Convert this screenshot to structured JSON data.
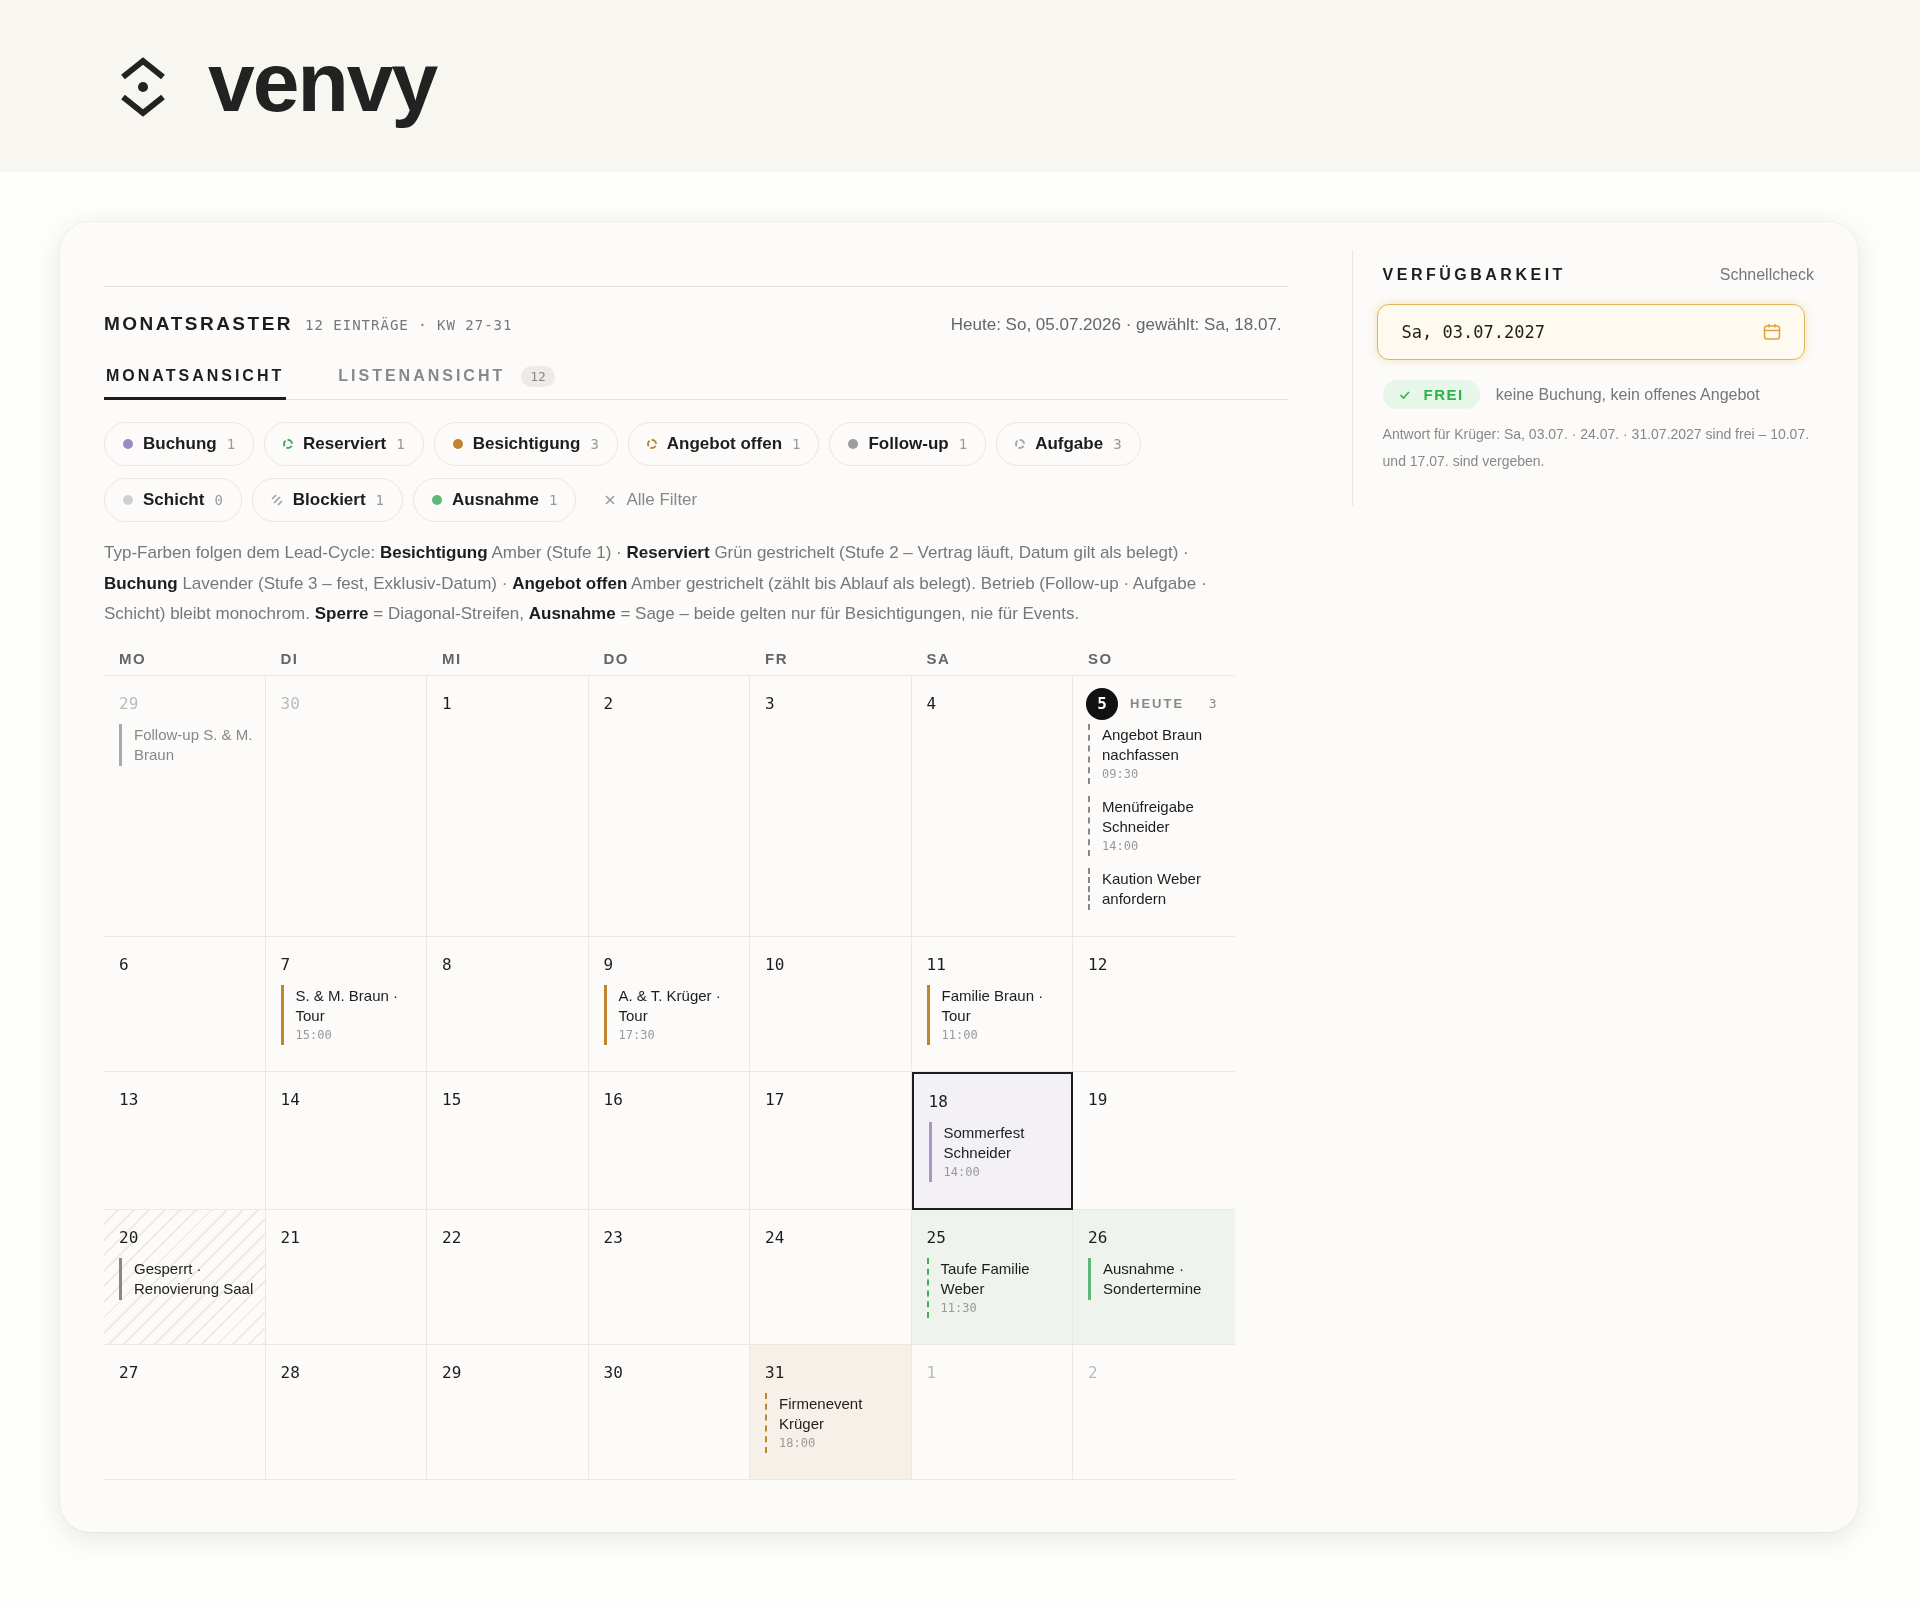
{
  "brand": {
    "name": "venvy"
  },
  "month": {
    "title": "MONATSRASTER",
    "meta": "12 EINTRÄGE · KW 27-31",
    "status": "Heute: So, 05.07.2026 · gewählt: Sa, 18.07.",
    "tabs": [
      {
        "label": "MONATSANSICHT",
        "selected": true
      },
      {
        "label": "LISTENANSICHT",
        "count": "12",
        "selected": false
      }
    ],
    "filters": [
      {
        "label": "Buchung",
        "count": "1",
        "kind": "dot",
        "color": "#9b8ac4"
      },
      {
        "label": "Reserviert",
        "count": "1",
        "kind": "ring",
        "color": "#3fae5c"
      },
      {
        "label": "Besichtigung",
        "count": "3",
        "kind": "dot",
        "color": "#c0842c"
      },
      {
        "label": "Angebot offen",
        "count": "1",
        "kind": "ring",
        "color": "#c0842c"
      },
      {
        "label": "Follow-up",
        "count": "1",
        "kind": "dot",
        "color": "#9e9e9e"
      },
      {
        "label": "Aufgabe",
        "count": "3",
        "kind": "ring",
        "color": "#a8a8a8"
      },
      {
        "label": "Schicht",
        "count": "0",
        "kind": "dot",
        "color": "#cfcfcf"
      },
      {
        "label": "Blockiert",
        "count": "1",
        "kind": "stripes",
        "color": "#9e9e9e"
      },
      {
        "label": "Ausnahme",
        "count": "1",
        "kind": "dot",
        "color": "#5fb87a"
      }
    ],
    "clear_filters": "Alle Filter",
    "legend": "Typ-Farben folgen dem Lead-Cycle: **Besichtigung** Amber (Stufe 1) · **Reserviert** Grün gestrichelt (Stufe 2 – Vertrag läuft, Datum gilt als belegt) · **Buchung** Lavender (Stufe 3 – fest, Exklusiv-Datum) · **Angebot offen** Amber gestrichelt (zählt bis Ablauf als belegt). Betrieb (Follow-up · Aufgabe · Schicht) bleibt monochrom. **Sperre** = Diagonal-Streifen, **Ausnahme** = Sage – beide gelten nur für Besichtigungen, nie für Events.",
    "weekdays": [
      "MO",
      "DI",
      "MI",
      "DO",
      "FR",
      "SA",
      "SO"
    ],
    "weeks": [
      {
        "days": [
          {
            "day": "29",
            "outside": true,
            "today": false,
            "selected": false,
            "events": [
              {
                "kind": "followup",
                "title": "Follow-up S. & M. Braun"
              }
            ]
          },
          {
            "day": "30",
            "outside": true,
            "today": false,
            "selected": false
          },
          {
            "day": "1",
            "outside": false,
            "today": false,
            "selected": false
          },
          {
            "day": "2",
            "outside": false,
            "today": false,
            "selected": false
          },
          {
            "day": "3",
            "outside": false,
            "today": false,
            "selected": false
          },
          {
            "day": "4",
            "outside": false,
            "today": false,
            "selected": false
          },
          {
            "day": "5",
            "outside": false,
            "today": true,
            "selected": false,
            "today_label": "HEUTE",
            "count": "3",
            "events": [
              {
                "kind": "task",
                "title": "Angebot Braun nachfassen",
                "time": "09:30"
              },
              {
                "kind": "task",
                "title": "Menüfreigabe Schneider",
                "time": "14:00"
              },
              {
                "kind": "task",
                "title": "Kaution Weber anfordern"
              }
            ]
          }
        ]
      },
      {
        "days": [
          {
            "day": "6",
            "outside": false,
            "today": false,
            "selected": false
          },
          {
            "day": "7",
            "outside": false,
            "today": false,
            "selected": false,
            "events": [
              {
                "kind": "viewing",
                "title": "S. & M. Braun · Tour",
                "time": "15:00"
              }
            ]
          },
          {
            "day": "8",
            "outside": false,
            "today": false,
            "selected": false
          },
          {
            "day": "9",
            "outside": false,
            "today": false,
            "selected": false,
            "events": [
              {
                "kind": "viewing",
                "title": "A. & T. Krüger · Tour",
                "time": "17:30"
              }
            ]
          },
          {
            "day": "10",
            "outside": false,
            "today": false,
            "selected": false
          },
          {
            "day": "11",
            "outside": false,
            "today": false,
            "selected": false,
            "events": [
              {
                "kind": "viewing",
                "title": "Familie Braun · Tour",
                "time": "11:00"
              }
            ]
          },
          {
            "day": "12",
            "outside": false,
            "today": false,
            "selected": false
          }
        ]
      },
      {
        "days": [
          {
            "day": "13",
            "outside": false,
            "today": false,
            "selected": false
          },
          {
            "day": "14",
            "outside": false,
            "today": false,
            "selected": false
          },
          {
            "day": "15",
            "outside": false,
            "today": false,
            "selected": false
          },
          {
            "day": "16",
            "outside": false,
            "today": false,
            "selected": false
          },
          {
            "day": "17",
            "outside": false,
            "today": false,
            "selected": false
          },
          {
            "day": "18",
            "outside": false,
            "today": false,
            "selected": true,
            "events": [
              {
                "kind": "booking",
                "title": "Sommerfest Schneider",
                "time": "14:00"
              }
            ]
          },
          {
            "day": "19",
            "outside": false,
            "today": false,
            "selected": false
          }
        ]
      },
      {
        "days": [
          {
            "day": "20",
            "outside": false,
            "today": false,
            "selected": false,
            "kind": "blocked",
            "events": [
              {
                "kind": "block",
                "title": "Gesperrt · Renovierung Saal"
              }
            ]
          },
          {
            "day": "21",
            "outside": false,
            "today": false,
            "selected": false
          },
          {
            "day": "22",
            "outside": false,
            "today": false,
            "selected": false
          },
          {
            "day": "23",
            "outside": false,
            "today": false,
            "selected": false
          },
          {
            "day": "24",
            "outside": false,
            "today": false,
            "selected": false
          },
          {
            "day": "25",
            "outside": false,
            "today": false,
            "selected": false,
            "kind": "sage",
            "events": [
              {
                "kind": "reserved",
                "title": "Taufe Familie Weber",
                "time": "11:30"
              }
            ]
          },
          {
            "day": "26",
            "outside": false,
            "today": false,
            "selected": false,
            "kind": "sage",
            "events": [
              {
                "kind": "exception",
                "title": "Ausnahme · Sondertermine"
              }
            ]
          }
        ]
      },
      {
        "days": [
          {
            "day": "27",
            "outside": false,
            "today": false,
            "selected": false
          },
          {
            "day": "28",
            "outside": false,
            "today": false,
            "selected": false
          },
          {
            "day": "29",
            "outside": false,
            "today": false,
            "selected": false
          },
          {
            "day": "30",
            "outside": false,
            "today": false,
            "selected": false
          },
          {
            "day": "31",
            "outside": false,
            "today": false,
            "selected": false,
            "kind": "offer",
            "events": [
              {
                "kind": "offer",
                "title": "Firmenevent Krüger",
                "time": "18:00"
              }
            ]
          },
          {
            "day": "1",
            "outside": true,
            "today": false,
            "selected": false
          },
          {
            "day": "2",
            "outside": true,
            "today": false,
            "selected": false
          }
        ]
      }
    ]
  },
  "availability": {
    "title": "VERFÜGBARKEIT",
    "subtitle": "Schnellcheck",
    "date": "Sa, 03.07.2027",
    "result": {
      "free": true,
      "label": "FREI",
      "text": "keine Buchung, kein offenes Angebot"
    },
    "note": "Antwort für Krüger: Sa, 03.07. · 24.07. · 31.07.2027 sind frei – 10.07. und 17.07. sind vergeben."
  }
}
